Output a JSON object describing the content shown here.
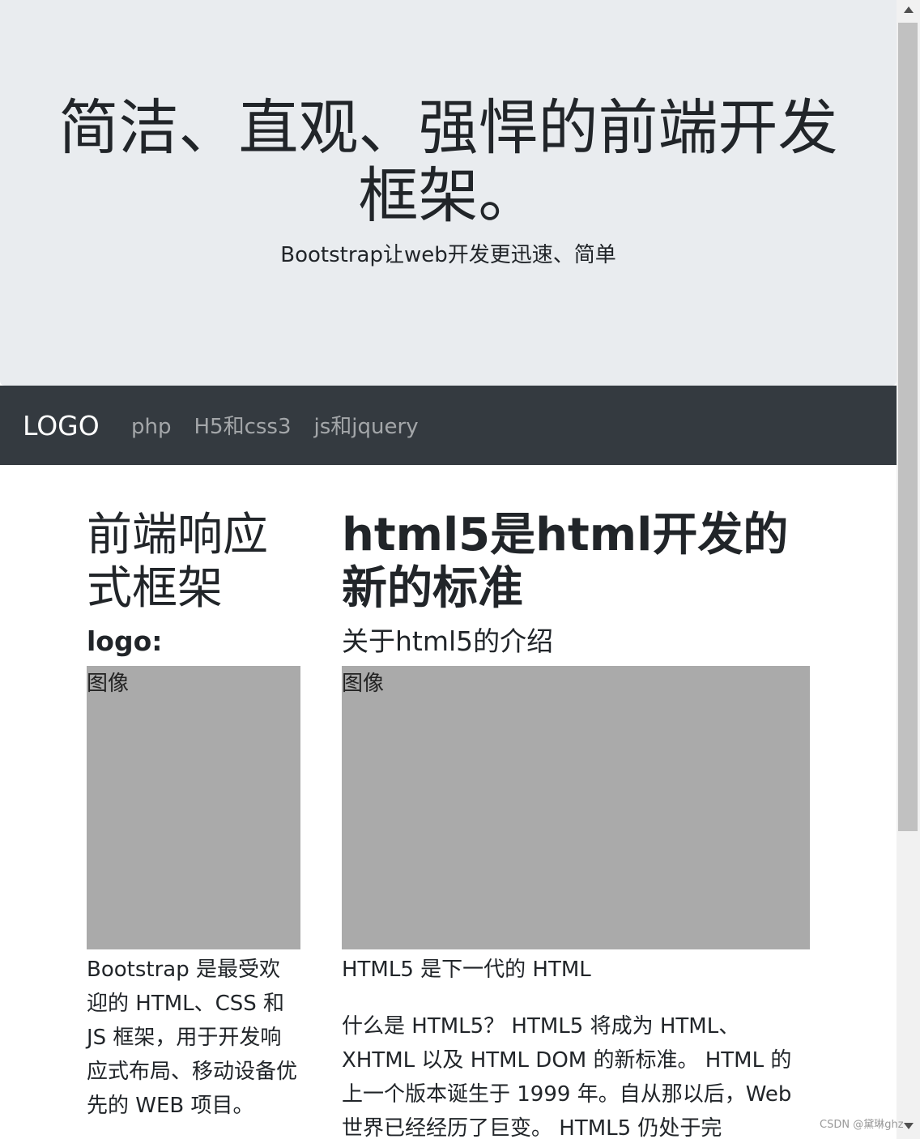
{
  "jumbotron": {
    "title": "简洁、直观、强悍的前端开发框架。",
    "subtitle": "Bootstrap让web开发更迅速、简单"
  },
  "navbar": {
    "brand": "LOGO",
    "links": [
      "php",
      "H5和css3",
      "js和jquery"
    ]
  },
  "left_column": {
    "heading": "前端响应式框架",
    "subheading": "logo:",
    "image_label": "图像",
    "text": "Bootstrap 是最受欢迎的 HTML、CSS 和 JS 框架，用于开发响应式布局、移动设备优先的 WEB 项目。"
  },
  "right_column": {
    "heading": "html5是html开发的新的标准",
    "subheading": "关于html5的介绍",
    "image_label": "图像",
    "text1": "HTML5 是下一代的 HTML",
    "text2": "什么是 HTML5？ HTML5 将成为 HTML、XHTML 以及 HTML DOM 的新标准。 HTML 的上一个版本诞生于 1999 年。自从那以后，Web 世界已经经历了巨变。 HTML5 仍处于完"
  },
  "watermark": "CSDN @黛琳ghz"
}
